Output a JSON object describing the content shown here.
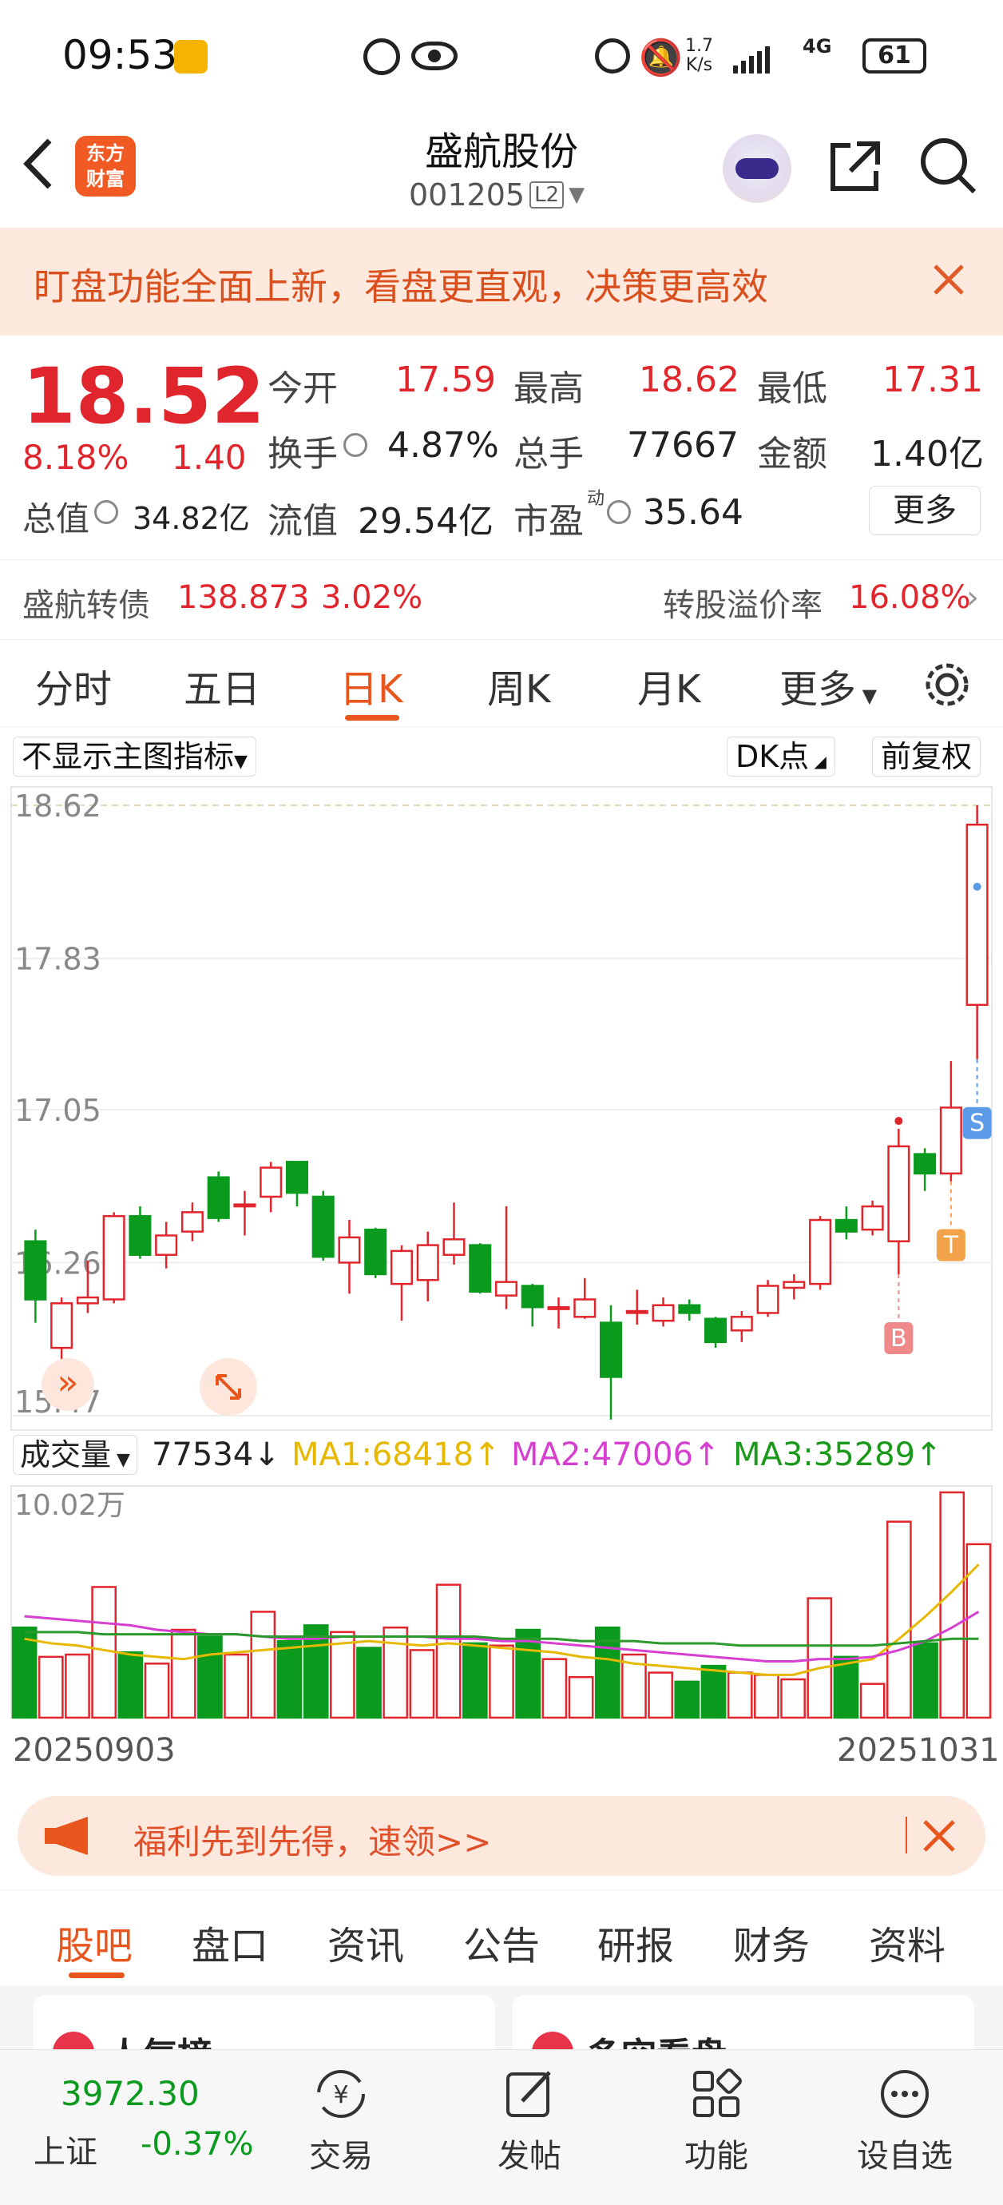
{
  "status_bar": {
    "time": "09:53",
    "speed_top": "1.7",
    "speed_unit": "K/s",
    "net": "4G",
    "battery": "61"
  },
  "nav": {
    "logo_line1": "东方",
    "logo_line2": "财富",
    "title": "盛航股份",
    "code": "001205",
    "level": "L2"
  },
  "banner": {
    "text": "盯盘功能全面上新，看盘更直观，决策更高效"
  },
  "quote": {
    "price": "18.52",
    "change_pct": "8.18%",
    "change": "1.40",
    "open_label": "今开",
    "open": "17.59",
    "high_label": "最高",
    "high": "18.62",
    "low_label": "最低",
    "low": "17.31",
    "turnover_label": "换手",
    "turnover": "4.87%",
    "volume_label": "总手",
    "volume": "77667",
    "amount_label": "金额",
    "amount": "1.40亿",
    "mktcap_label": "总值",
    "mktcap": "34.82亿",
    "float_label": "流值",
    "float": "29.54亿",
    "pe_label": "市盈",
    "pe_sup": "动",
    "pe": "35.64",
    "more": "更多"
  },
  "bond": {
    "name": "盛航转债",
    "price": "138.873",
    "pct": "3.02%",
    "premium_label": "转股溢价率",
    "premium": "16.08%"
  },
  "chart_tabs": [
    "分时",
    "五日",
    "日K",
    "周K",
    "月K",
    "更多"
  ],
  "active_tab": "日K",
  "indicator_select": "不显示主图指标",
  "dk_button": "DK点",
  "adjust_button": "前复权",
  "price_axis": [
    "18.62",
    "17.83",
    "17.05",
    "16.26",
    "15.47"
  ],
  "markers": {
    "b": "B",
    "s": "S",
    "t": "T"
  },
  "volume_header": {
    "select": "成交量",
    "value": "77534↓",
    "ma1": "MA1:68418↑",
    "ma2": "MA2:47006↑",
    "ma3": "MA3:35289↑"
  },
  "volume_axis_max": "10.02万",
  "date_start": "20250903",
  "date_end": "20251031",
  "promo": {
    "text": "福利先到先得，速领>>"
  },
  "info_tabs": [
    "股吧",
    "盘口",
    "资讯",
    "公告",
    "研报",
    "财务",
    "资料"
  ],
  "cards": {
    "left": "人气榜",
    "right": "多空看盘"
  },
  "bottom": {
    "index_value": "3972.30",
    "index_name": "上证",
    "index_pct": "-0.37%",
    "trade": "交易",
    "post": "发帖",
    "func": "功能",
    "watch": "设自选"
  },
  "colors": {
    "up": "#e0262c",
    "down": "#0a9a1e",
    "accent": "#f15a22"
  },
  "chart_data": {
    "type": "candlestick",
    "y_range": [
      15.47,
      18.62
    ],
    "x_range": [
      "20250903",
      "20251031"
    ],
    "candles": [
      {
        "o": 16.37,
        "c": 16.07,
        "h": 16.43,
        "l": 15.95
      },
      {
        "o": 15.82,
        "c": 16.05,
        "h": 16.08,
        "l": 15.72
      },
      {
        "o": 16.05,
        "c": 16.08,
        "h": 16.27,
        "l": 16.0
      },
      {
        "o": 16.07,
        "c": 16.5,
        "h": 16.52,
        "l": 16.05
      },
      {
        "o": 16.5,
        "c": 16.3,
        "h": 16.55,
        "l": 16.28
      },
      {
        "o": 16.3,
        "c": 16.4,
        "h": 16.47,
        "l": 16.23
      },
      {
        "o": 16.42,
        "c": 16.52,
        "h": 16.57,
        "l": 16.37
      },
      {
        "o": 16.7,
        "c": 16.49,
        "h": 16.73,
        "l": 16.47
      },
      {
        "o": 16.55,
        "c": 16.56,
        "h": 16.63,
        "l": 16.4
      },
      {
        "o": 16.6,
        "c": 16.75,
        "h": 16.78,
        "l": 16.52
      },
      {
        "o": 16.78,
        "c": 16.62,
        "h": 16.78,
        "l": 16.55
      },
      {
        "o": 16.6,
        "c": 16.29,
        "h": 16.63,
        "l": 16.27
      },
      {
        "o": 16.26,
        "c": 16.39,
        "h": 16.48,
        "l": 16.1
      },
      {
        "o": 16.43,
        "c": 16.2,
        "h": 16.44,
        "l": 16.18
      },
      {
        "o": 16.15,
        "c": 16.32,
        "h": 16.35,
        "l": 15.96
      },
      {
        "o": 16.17,
        "c": 16.35,
        "h": 16.42,
        "l": 16.06
      },
      {
        "o": 16.3,
        "c": 16.38,
        "h": 16.57,
        "l": 16.25
      },
      {
        "o": 16.35,
        "c": 16.11,
        "h": 16.36,
        "l": 16.1
      },
      {
        "o": 16.09,
        "c": 16.16,
        "h": 16.55,
        "l": 16.02
      },
      {
        "o": 16.14,
        "c": 16.03,
        "h": 16.15,
        "l": 15.93
      },
      {
        "o": 16.02,
        "c": 16.03,
        "h": 16.08,
        "l": 15.92
      },
      {
        "o": 15.98,
        "c": 16.07,
        "h": 16.18,
        "l": 15.97
      },
      {
        "o": 15.95,
        "c": 15.67,
        "h": 16.04,
        "l": 15.45
      },
      {
        "o": 16.0,
        "c": 16.01,
        "h": 16.12,
        "l": 15.94
      },
      {
        "o": 15.96,
        "c": 16.04,
        "h": 16.08,
        "l": 15.93
      },
      {
        "o": 16.04,
        "c": 16.0,
        "h": 16.07,
        "l": 15.96
      },
      {
        "o": 15.97,
        "c": 15.85,
        "h": 15.98,
        "l": 15.82
      },
      {
        "o": 15.91,
        "c": 15.98,
        "h": 16.01,
        "l": 15.85
      },
      {
        "o": 16.0,
        "c": 16.14,
        "h": 16.17,
        "l": 15.98
      },
      {
        "o": 16.13,
        "c": 16.16,
        "h": 16.2,
        "l": 16.07
      },
      {
        "o": 16.15,
        "c": 16.48,
        "h": 16.5,
        "l": 16.12
      },
      {
        "o": 16.48,
        "c": 16.42,
        "h": 16.55,
        "l": 16.38
      },
      {
        "o": 16.43,
        "c": 16.55,
        "h": 16.58,
        "l": 16.4
      },
      {
        "o": 16.37,
        "c": 16.86,
        "h": 16.95,
        "l": 16.2
      },
      {
        "o": 16.82,
        "c": 16.72,
        "h": 16.85,
        "l": 16.63
      },
      {
        "o": 16.72,
        "c": 17.06,
        "h": 17.3,
        "l": 16.68
      },
      {
        "o": 17.59,
        "c": 18.52,
        "h": 18.62,
        "l": 17.31
      }
    ],
    "volume_max": 100200,
    "volumes": [
      {
        "v": 40,
        "up": false
      },
      {
        "v": 27,
        "up": true
      },
      {
        "v": 28,
        "up": true
      },
      {
        "v": 58,
        "up": true
      },
      {
        "v": 29,
        "up": false
      },
      {
        "v": 24,
        "up": true
      },
      {
        "v": 39,
        "up": true
      },
      {
        "v": 36,
        "up": false
      },
      {
        "v": 28,
        "up": true
      },
      {
        "v": 47,
        "up": true
      },
      {
        "v": 34,
        "up": false
      },
      {
        "v": 41,
        "up": false
      },
      {
        "v": 38,
        "up": true
      },
      {
        "v": 31,
        "up": false
      },
      {
        "v": 40,
        "up": true
      },
      {
        "v": 30,
        "up": true
      },
      {
        "v": 59,
        "up": true
      },
      {
        "v": 33,
        "up": false
      },
      {
        "v": 32,
        "up": true
      },
      {
        "v": 39,
        "up": false
      },
      {
        "v": 26,
        "up": true
      },
      {
        "v": 18,
        "up": true
      },
      {
        "v": 40,
        "up": false
      },
      {
        "v": 28,
        "up": true
      },
      {
        "v": 20,
        "up": true
      },
      {
        "v": 16,
        "up": false
      },
      {
        "v": 23,
        "up": false
      },
      {
        "v": 20,
        "up": true
      },
      {
        "v": 19,
        "up": true
      },
      {
        "v": 17,
        "up": true
      },
      {
        "v": 53,
        "up": true
      },
      {
        "v": 27,
        "up": false
      },
      {
        "v": 15,
        "up": true
      },
      {
        "v": 87,
        "up": true
      },
      {
        "v": 33,
        "up": false
      },
      {
        "v": 100,
        "up": true
      },
      {
        "v": 77,
        "up": true
      }
    ],
    "ma_series": [
      {
        "name": "MA1",
        "color": "#e6b800",
        "values": [
          35,
          33,
          32,
          30,
          28,
          27,
          26,
          28,
          29,
          30,
          31,
          32,
          33,
          34,
          33,
          32,
          33,
          32,
          31,
          30,
          29,
          27,
          26,
          24,
          23,
          22,
          21,
          20,
          19,
          19,
          22,
          24,
          26,
          35,
          45,
          56,
          68
        ]
      },
      {
        "name": "MA2",
        "color": "#d63fd0",
        "values": [
          45,
          44,
          43,
          42,
          41,
          39,
          38,
          37,
          37,
          36,
          35,
          35,
          36,
          36,
          36,
          36,
          35,
          35,
          34,
          34,
          33,
          32,
          31,
          30,
          29,
          28,
          27,
          26,
          25,
          25,
          26,
          26,
          27,
          30,
          34,
          40,
          47
        ]
      },
      {
        "name": "MA3",
        "color": "#2a9a2a",
        "values": [
          38,
          38,
          38,
          37,
          37,
          37,
          37,
          37,
          37,
          36,
          36,
          36,
          36,
          36,
          36,
          36,
          36,
          36,
          35,
          35,
          35,
          34,
          34,
          34,
          33,
          33,
          33,
          32,
          32,
          32,
          32,
          32,
          32,
          33,
          34,
          35,
          35
        ]
      }
    ]
  }
}
